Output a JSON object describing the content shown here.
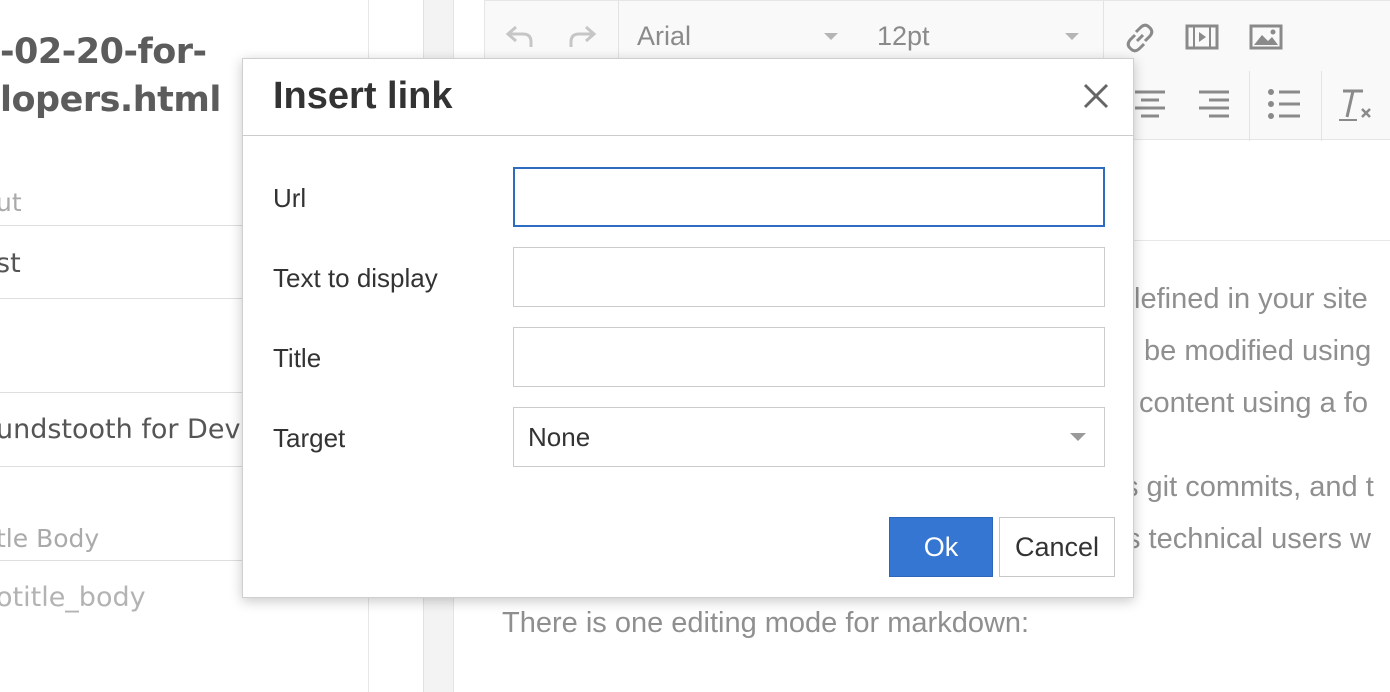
{
  "sidebar": {
    "file_title_line1": "-02-20-for-",
    "file_title_line2": "lopers.html",
    "fields": [
      {
        "label": "ut",
        "value": "st"
      },
      {
        "label": "",
        "value": "undstooth for Dev"
      },
      {
        "label": "tle Body",
        "value": "otitle_body"
      }
    ]
  },
  "toolbar": {
    "font_family": "Arial",
    "font_size": "12pt",
    "icons": [
      "undo-icon",
      "redo-icon",
      "link-icon",
      "media-icon",
      "image-icon",
      "align-center-icon",
      "align-right-icon",
      "bullet-list-icon",
      "clear-formatting-icon"
    ]
  },
  "editor": {
    "lines": [
      "lefined in your site",
      "be modified using",
      "content using a fo",
      "s git commits, and t",
      "s technical users w",
      "There is one editing mode for markdown:"
    ]
  },
  "dialog": {
    "title": "Insert link",
    "close_glyph": "×",
    "fields": {
      "url_label": "Url",
      "url_value": "",
      "text_label": "Text to display",
      "text_value": "",
      "title_label": "Title",
      "title_value": "",
      "target_label": "Target",
      "target_value": "None"
    },
    "ok_label": "Ok",
    "cancel_label": "Cancel",
    "accent_color": "#3576d2",
    "focus_color": "#2d6cc0"
  }
}
